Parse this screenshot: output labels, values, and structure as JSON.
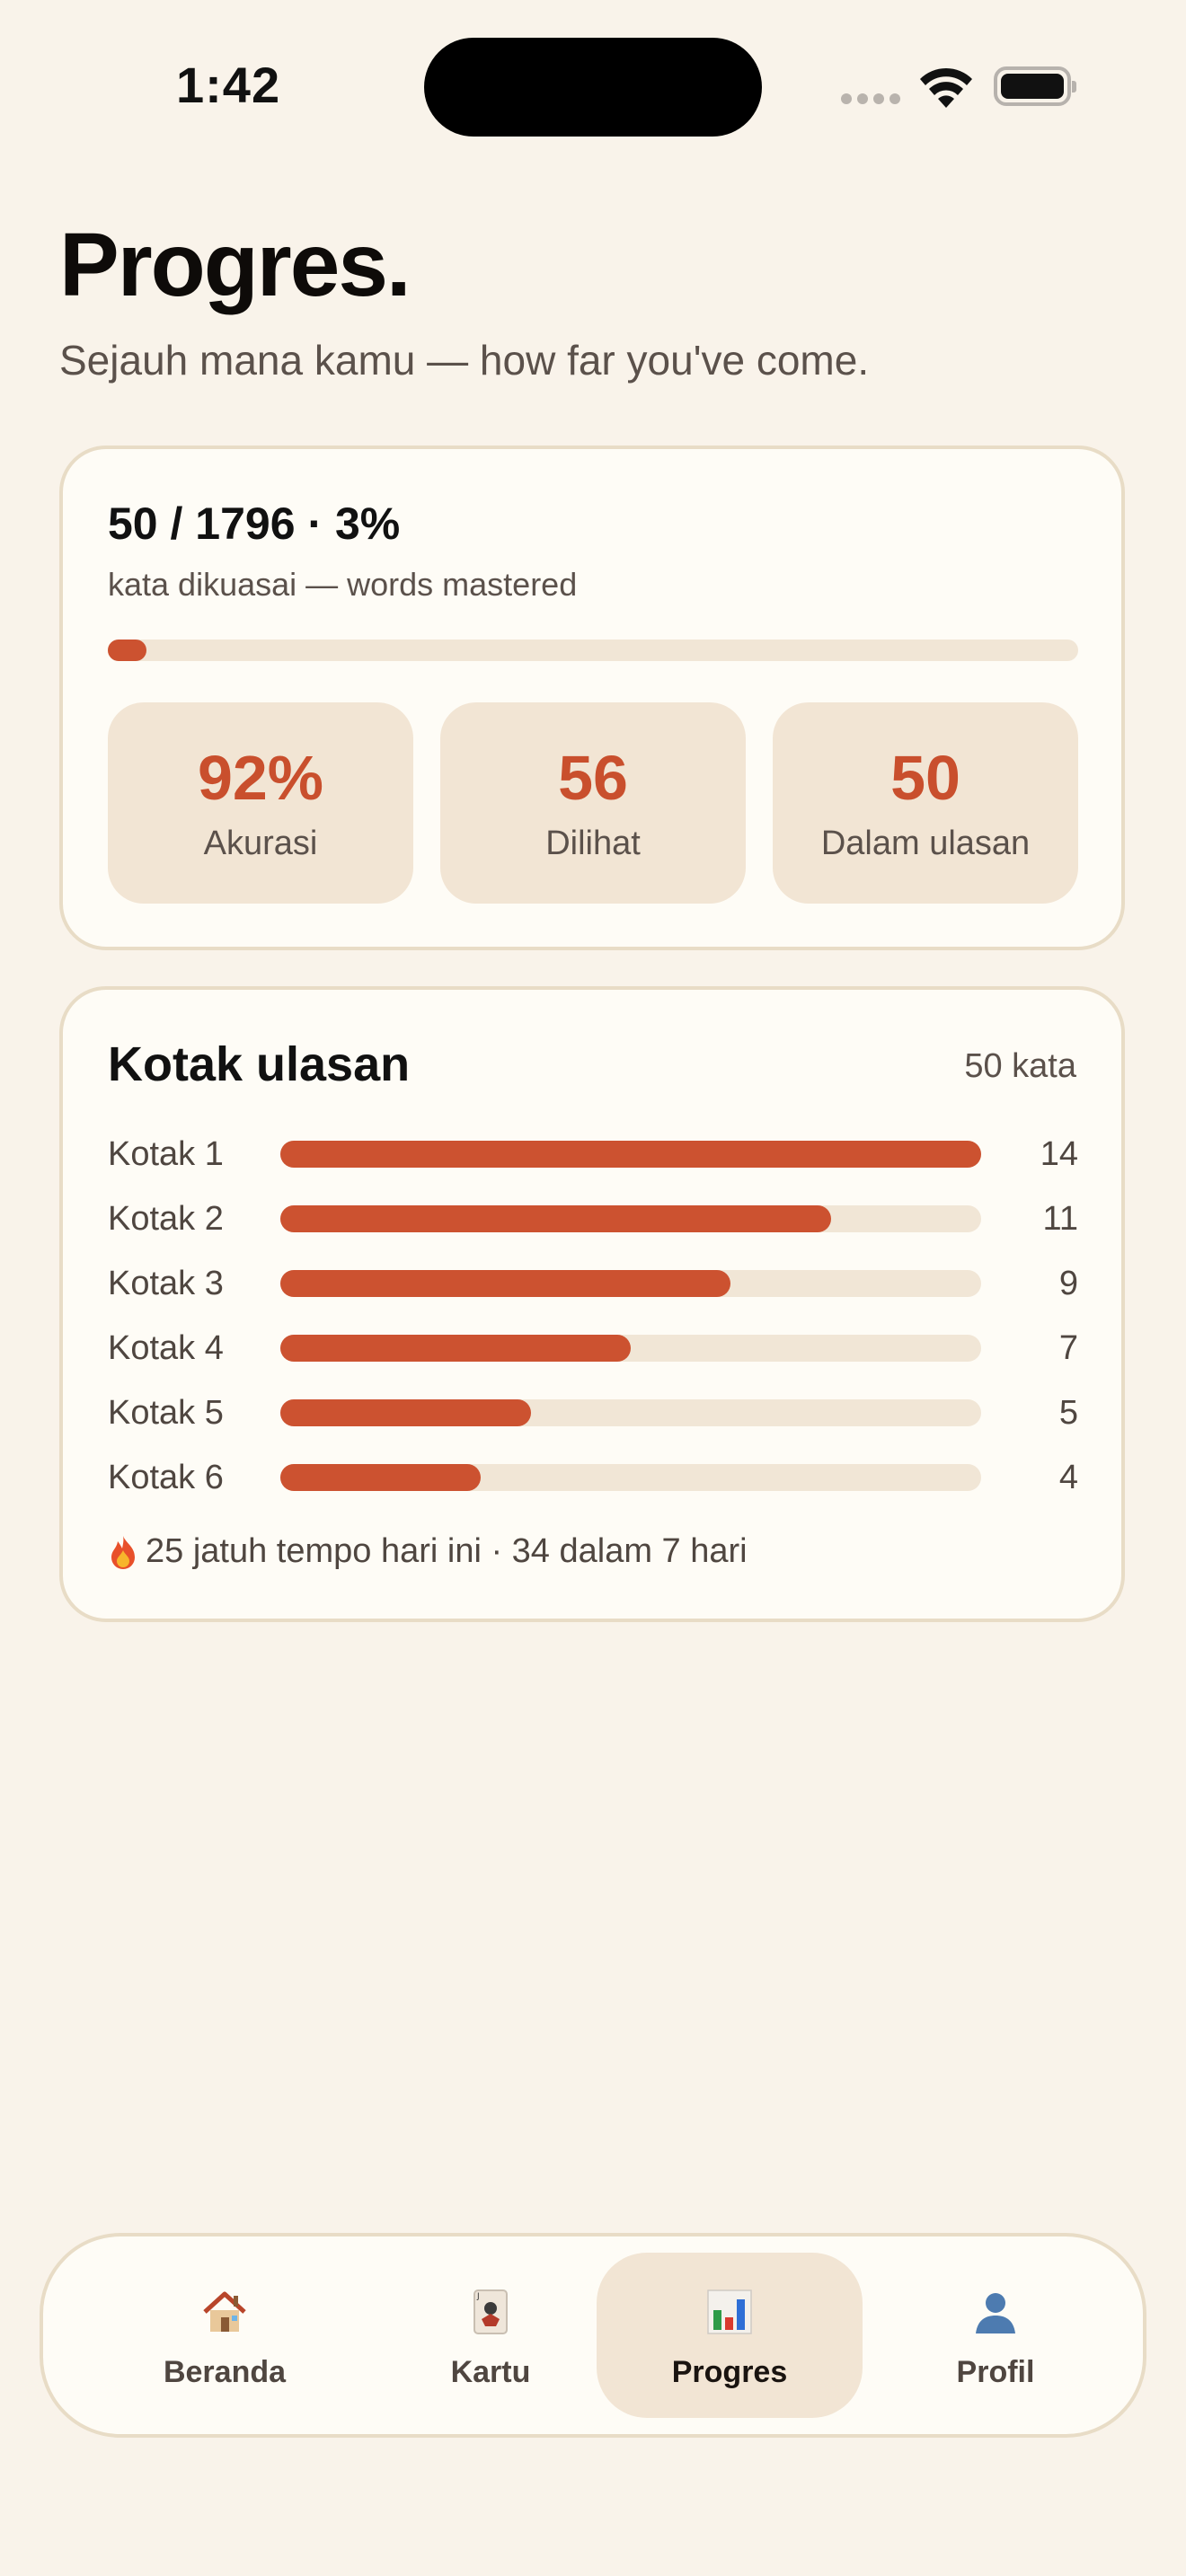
{
  "status_bar": {
    "time": "1:42"
  },
  "header": {
    "title": "Progres.",
    "subtitle": "Sejauh mana kamu — how far you've come."
  },
  "mastery": {
    "headline": "50 / 1796 · 3%",
    "caption": "kata dikuasai — words mastered",
    "progress_percent": 3,
    "stats": [
      {
        "value": "92%",
        "label": "Akurasi"
      },
      {
        "value": "56",
        "label": "Dilihat"
      },
      {
        "value": "50",
        "label": "Dalam ulasan"
      }
    ]
  },
  "review_boxes": {
    "title": "Kotak ulasan",
    "count_label": "50 kata",
    "boxes": [
      {
        "label": "Kotak 1",
        "value": 14
      },
      {
        "label": "Kotak 2",
        "value": 11
      },
      {
        "label": "Kotak 3",
        "value": 9
      },
      {
        "label": "Kotak 4",
        "value": 7
      },
      {
        "label": "Kotak 5",
        "value": 5
      },
      {
        "label": "Kotak 6",
        "value": 4
      }
    ],
    "due_text": "25 jatuh tempo hari ini · 34 dalam 7 hari",
    "accent_color": "#cc5230"
  },
  "tab_bar": {
    "active": "Progres",
    "tabs": [
      {
        "label": "Beranda",
        "icon": "house-icon"
      },
      {
        "label": "Kartu",
        "icon": "playing-card-icon"
      },
      {
        "label": "Progres",
        "icon": "bar-chart-icon"
      },
      {
        "label": "Profil",
        "icon": "person-icon"
      }
    ]
  }
}
